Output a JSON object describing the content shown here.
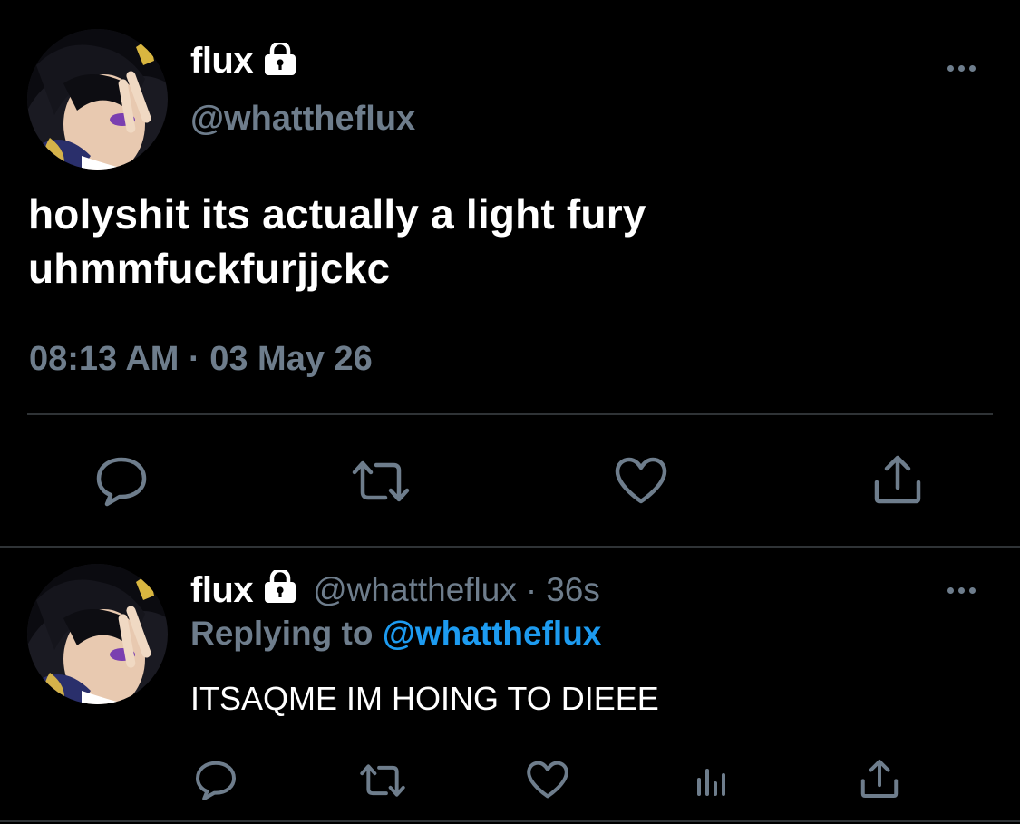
{
  "main_tweet": {
    "name": "flux",
    "handle": "@whattheflux",
    "text_line1": "holyshit its actually a light fury",
    "text_line2": "uhmmfuckfurjjckc",
    "time": "08:13 AM",
    "separator": "·",
    "date": "03 May 26"
  },
  "reply": {
    "name": "flux",
    "handle": "@whattheflux",
    "separator": "·",
    "age": "36s",
    "replying_prefix": "Replying to",
    "replying_mention": "@whattheflux",
    "text": "ITSAQME IM HOING TO DIEEE"
  },
  "colors": {
    "background": "#000000",
    "secondary_text": "#6e7d8c",
    "mention_blue": "#1d9bf0",
    "divider": "#2f3336"
  },
  "icons": {
    "lock": "lock-icon",
    "more": "more-icon",
    "reply": "reply-icon",
    "retweet": "retweet-icon",
    "like": "like-icon",
    "share": "share-icon",
    "analytics": "analytics-icon"
  }
}
